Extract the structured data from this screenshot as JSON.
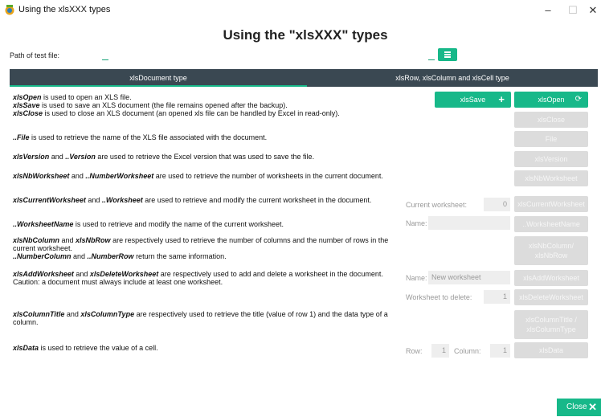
{
  "window": {
    "title": "Using the xlsXXX types",
    "min": "–",
    "max": "☐",
    "close": "✕"
  },
  "heading": "Using the \"xlsXXX\" types",
  "path_label": "Path of test file:",
  "tabs": [
    "xlsDocument type",
    "xlsRow, xlsColumn and xlsCell type"
  ],
  "descriptions": {
    "open": {
      "k1": "xlsOpen",
      "t1": " is used to open an XLS file."
    },
    "save": {
      "k1": "xlsSave",
      "t1": " is used to save an XLS document (the file remains opened after the backup)."
    },
    "close": {
      "k1": "xlsClose",
      "t1": " is used to close an XLS document (an opened xls file can be handled by Excel in read-only)."
    },
    "file": {
      "k1": "..File",
      "t1": " is used to retrieve the name of the XLS file associated with the document."
    },
    "version": {
      "k1": "xlsVersion",
      "t1": " and ",
      "k2": "..Version",
      "t2": " are used to retrieve the Excel version that was used to save the file."
    },
    "nbworksheet": {
      "k1": "xlsNbWorksheet",
      "t1": " and ",
      "k2": "..NumberWorksheet",
      "t2": " are used to retrieve the number of worksheets in the current document."
    },
    "curworksheet": {
      "k1": "xlsCurrentWorksheet",
      "t1": " and ",
      "k2": "..Worksheet",
      "t2": " are used to retrieve and modify the current worksheet in the document."
    },
    "wsname": {
      "k1": "..WorksheetName",
      "t1": " is used to retrieve and modify the name of the current worksheet."
    },
    "nbcol": {
      "k1": "xlsNbColumn",
      "t1": " and ",
      "k2": "xlsNbRow",
      "t2": " are respectively used to retrieve the number of columns and the number of rows in the current worksheet.",
      "k3": "..NumberColumn",
      "t3": " and ",
      "k4": "..NumberRow",
      "t4": " return the same information."
    },
    "addws": {
      "k1": "xlsAddWorksheet",
      "t1": " and ",
      "k2": "xlsDeleteWorksheet",
      "t2": " are respectively used to add and delete a worksheet in the document.",
      "caution": "Caution: a document must always include at least one worksheet."
    },
    "coltitle": {
      "k1": "xlsColumnTitle",
      "t1": " and ",
      "k2": "xlsColumnType",
      "t2": " are respectively used to retrieve the title (value of row 1) and the data type of a column."
    },
    "data": {
      "k1": "xlsData",
      "t1": " is used to retrieve the value of a cell."
    }
  },
  "buttons": {
    "save": "xlsSave",
    "open": "xlsOpen",
    "close": "xlsClose",
    "file": "File",
    "version": "xlsVersion",
    "nbworksheet": "xlsNbWorksheet",
    "curworksheet": "xlsCurrentWorksheet",
    "wsname": "..WorksheetName",
    "nbcol_l1": "xlsNbColumn/",
    "nbcol_l2": "xlsNbRow",
    "addws": "xlsAddWorksheet",
    "delws": "xlsDeleteWorksheet",
    "coltitle_l1": "xlsColumnTitle /",
    "coltitle_l2": "xlsColumnType",
    "data": "xlsData",
    "close_dialog": "Close"
  },
  "fields": {
    "current_ws_label": "Current worksheet:",
    "current_ws_value": "0",
    "name_label": "Name:",
    "name_value": "",
    "add_name_label": "Name:",
    "add_name_value": "New worksheet",
    "delete_label": "Worksheet to delete:",
    "delete_value": "1",
    "row_label": "Row:",
    "row_value": "1",
    "col_label": "Column:",
    "col_value": "1"
  },
  "colors": {
    "accent": "#17b889",
    "tabbar": "#3a4852",
    "disabled": "#dcdcdc"
  }
}
